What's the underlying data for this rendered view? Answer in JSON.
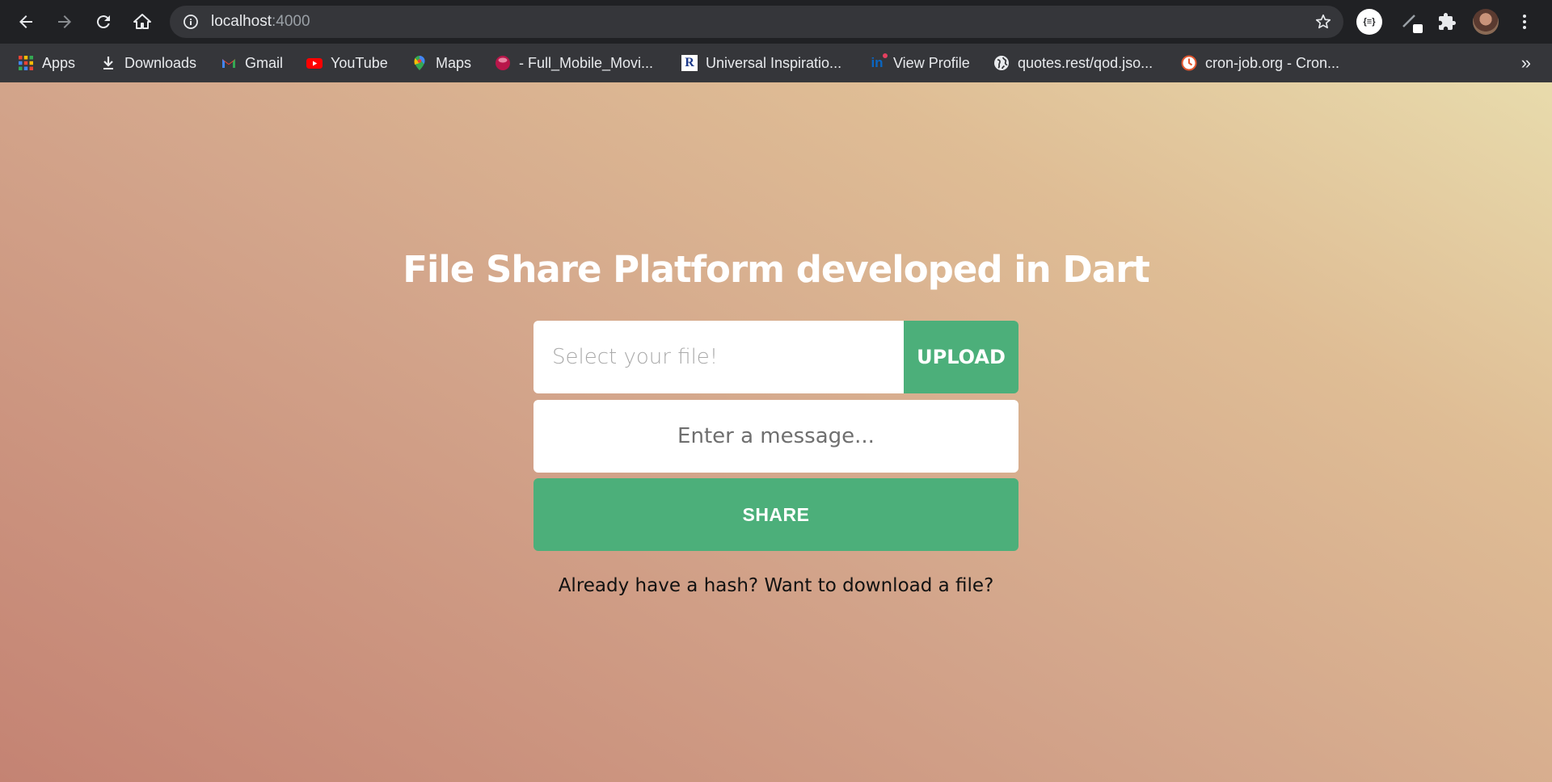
{
  "browser": {
    "url_host": "localhost",
    "url_port": ":4000",
    "bookmarks": [
      {
        "label": "Apps",
        "icon": "apps-grid-icon"
      },
      {
        "label": "Downloads",
        "icon": "download-icon"
      },
      {
        "label": "Gmail",
        "icon": "gmail-icon"
      },
      {
        "label": "YouTube",
        "icon": "youtube-icon"
      },
      {
        "label": "Maps",
        "icon": "maps-pin-icon"
      },
      {
        "label": "- Full_Mobile_Movi...",
        "icon": "red-ball-icon"
      },
      {
        "label": "Universal Inspiratio...",
        "icon": "r-logo-icon"
      },
      {
        "label": "View Profile",
        "icon": "linkedin-icon"
      },
      {
        "label": "quotes.rest/qod.jso...",
        "icon": "globe-icon"
      },
      {
        "label": "cron-job.org - Cron...",
        "icon": "clock-icon"
      }
    ],
    "more_bookmarks": "»",
    "extension_label": "{≡}"
  },
  "page": {
    "title": "File Share Platform developed in Dart",
    "file_placeholder": "Select your file!",
    "upload_label": "UPLOAD",
    "message_placeholder": "Enter a message...",
    "share_label": "SHARE",
    "download_link": "Already have a hash? Want to download a file?"
  },
  "colors": {
    "accent_green": "#4caf7a",
    "title_white": "#ffffff"
  }
}
